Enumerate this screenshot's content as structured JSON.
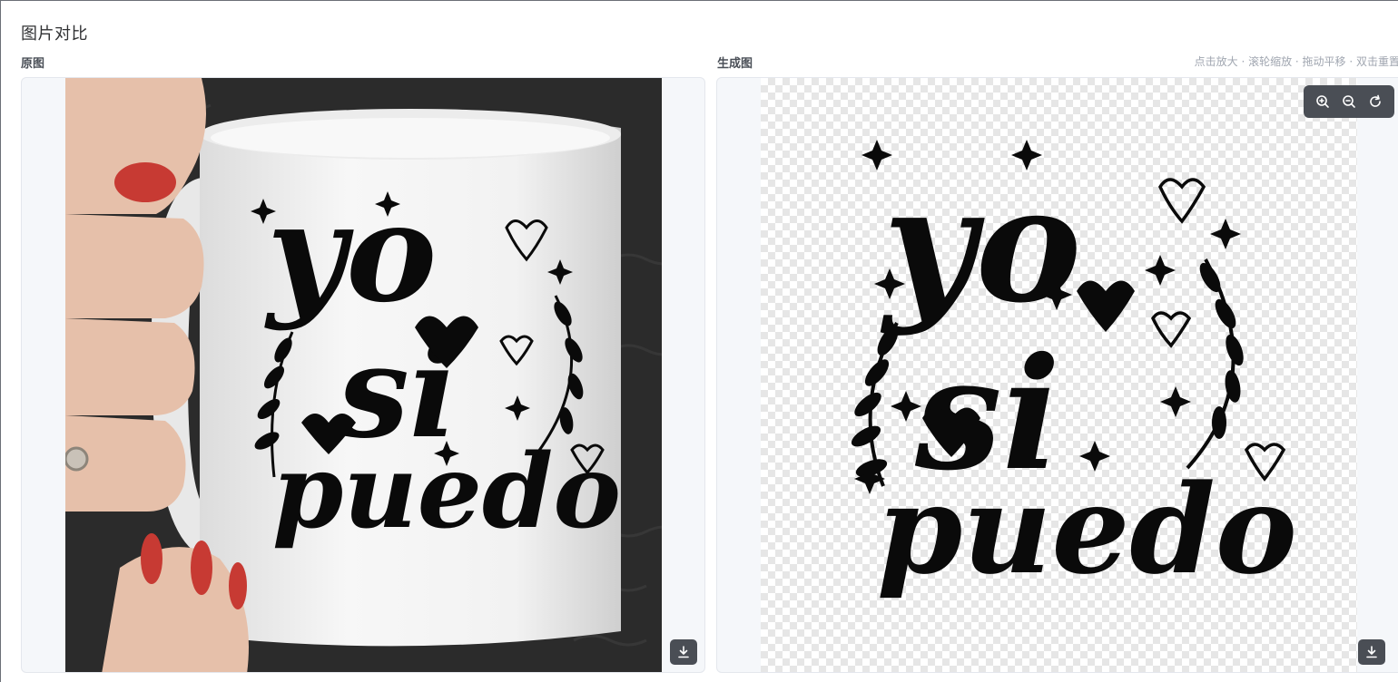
{
  "page": {
    "title": "图片对比"
  },
  "left_panel": {
    "label": "原图",
    "image_alt": "Original photo: hand holding white mug printed with 'yo si puedo'",
    "artwork_text": [
      "yo",
      "si",
      "puedo"
    ]
  },
  "right_panel": {
    "label": "生成图",
    "hint": "点击放大 · 滚轮缩放 · 拖动平移 · 双击重置",
    "image_alt": "Generated image: 'yo si puedo' lettering on transparent background",
    "artwork_text": [
      "yo",
      "si",
      "puedo"
    ]
  },
  "toolbar": {
    "icons": [
      "zoom-in-icon",
      "zoom-out-icon",
      "reset-icon"
    ]
  },
  "colors": {
    "toolbar_bg": "#4a4e55",
    "panel_bg": "#f5f7fa",
    "hint": "#a0a6b0"
  }
}
